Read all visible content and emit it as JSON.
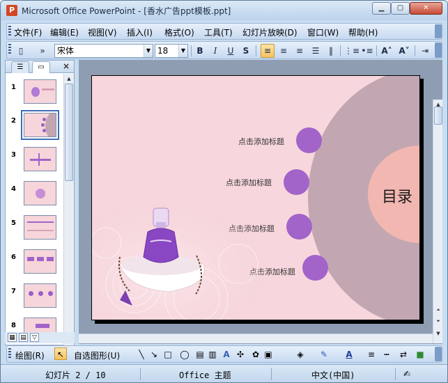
{
  "window": {
    "title": "Microsoft Office PowerPoint - [香水广告ppt模板.ppt]",
    "app_icon": "P"
  },
  "menu": [
    "文件(F)",
    "编辑(E)",
    "视图(V)",
    "插入(I)",
    "格式(O)",
    "工具(T)",
    "幻灯片放映(D)",
    "窗口(W)",
    "帮助(H)"
  ],
  "toolbar": {
    "font_name": "宋体",
    "font_size": "18",
    "bold": "B",
    "italic": "I",
    "underline": "U",
    "shadow": "S"
  },
  "slides_panel": {
    "numbers": [
      "1",
      "2",
      "3",
      "4",
      "5",
      "6",
      "7",
      "8"
    ],
    "selected": "2"
  },
  "slide": {
    "toc_title": "目录",
    "items": [
      "点击添加标题",
      "点击添加标题",
      "点击添加标题",
      "点击添加标题"
    ]
  },
  "drawbar": {
    "draw_label": "绘图(R)",
    "autoshapes_label": "自选图形(U)"
  },
  "status": {
    "slide_info": "幻灯片 2 / 10",
    "theme": "Office 主题",
    "language": "中文(中国)"
  },
  "colors": {
    "accent_purple": "#a264c9",
    "slide_bg": "#f7d7dd",
    "big_circle": "#c2a7b2",
    "inner_circle": "#f2b7b1"
  }
}
